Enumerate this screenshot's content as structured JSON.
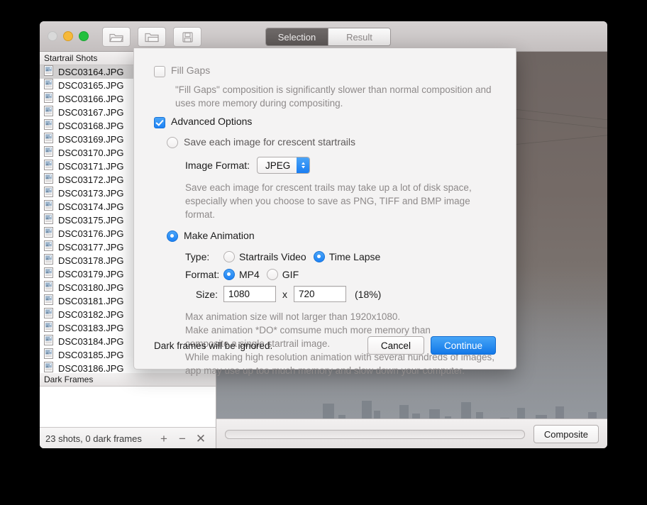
{
  "window": {
    "traffic_lights": [
      "close",
      "minimize",
      "maximize"
    ],
    "toolbar_buttons": [
      {
        "name": "open-folder-icon",
        "label": "Open"
      },
      {
        "name": "add-folder-icon",
        "label": "Add Folder"
      },
      {
        "name": "save-icon",
        "label": "Save"
      }
    ],
    "segmented": {
      "selection_label": "Selection",
      "result_label": "Result",
      "active": "Selection"
    }
  },
  "sidebar": {
    "shots_header": "Startrail Shots",
    "dark_header": "Dark Frames",
    "shots": [
      "DSC03164.JPG",
      "DSC03165.JPG",
      "DSC03166.JPG",
      "DSC03167.JPG",
      "DSC03168.JPG",
      "DSC03169.JPG",
      "DSC03170.JPG",
      "DSC03171.JPG",
      "DSC03172.JPG",
      "DSC03173.JPG",
      "DSC03174.JPG",
      "DSC03175.JPG",
      "DSC03176.JPG",
      "DSC03177.JPG",
      "DSC03178.JPG",
      "DSC03179.JPG",
      "DSC03180.JPG",
      "DSC03181.JPG",
      "DSC03182.JPG",
      "DSC03183.JPG",
      "DSC03184.JPG",
      "DSC03185.JPG",
      "DSC03186.JPG"
    ],
    "selected_index": 0,
    "dark_frames": [],
    "status_text": "23 shots, 0 dark frames",
    "add_label": "+",
    "remove_label": "−",
    "clear_label": "✕"
  },
  "bottom": {
    "progress_percent": 0,
    "composite_label": "Composite"
  },
  "sheet": {
    "fill_gaps": {
      "label": "Fill Gaps",
      "checked": false,
      "help_line1": "\"Fill Gaps\" composition is significantly slower than normal composition and",
      "help_line2": "uses more memory during compositing."
    },
    "advanced_options": {
      "label": "Advanced Options",
      "checked": true
    },
    "save_each": {
      "label": "Save each image for crescent startrails",
      "selected": false,
      "format_label": "Image Format:",
      "format_value": "JPEG",
      "help_line1": "Save each image for crescent trails may take up a lot of disk space,",
      "help_line2": "especially when you choose to save as PNG, TIFF and BMP image format."
    },
    "make_animation": {
      "label": "Make Animation",
      "selected": true,
      "type_label": "Type:",
      "type_options": [
        {
          "label": "Startrails Video",
          "selected": false
        },
        {
          "label": "Time Lapse",
          "selected": true
        }
      ],
      "format_label": "Format:",
      "format_options": [
        {
          "label": "MP4",
          "selected": true
        },
        {
          "label": "GIF",
          "selected": false
        }
      ],
      "size_label": "Size:",
      "size_width": "1080",
      "size_separator": "x",
      "size_height": "720",
      "size_percent": "(18%)",
      "help_line1": "Max animation size will not larger than 1920x1080.",
      "help_line2": "Make animation *DO* comsume much more memory than",
      "help_line3": "composite a single startrail image.",
      "help_line4": "While making high resolution animation with several hundreds of images,",
      "help_line5": "app may use up too much memory and slow down your computer."
    },
    "footer": {
      "note": "Dark frames will be ignored.",
      "cancel_label": "Cancel",
      "continue_label": "Continue"
    }
  },
  "colors": {
    "accent_blue": "#1d82f5",
    "primary_button": "#1278e8",
    "selection_gray": "#d2d0d0",
    "sheet_background": "#f4f3f3"
  }
}
